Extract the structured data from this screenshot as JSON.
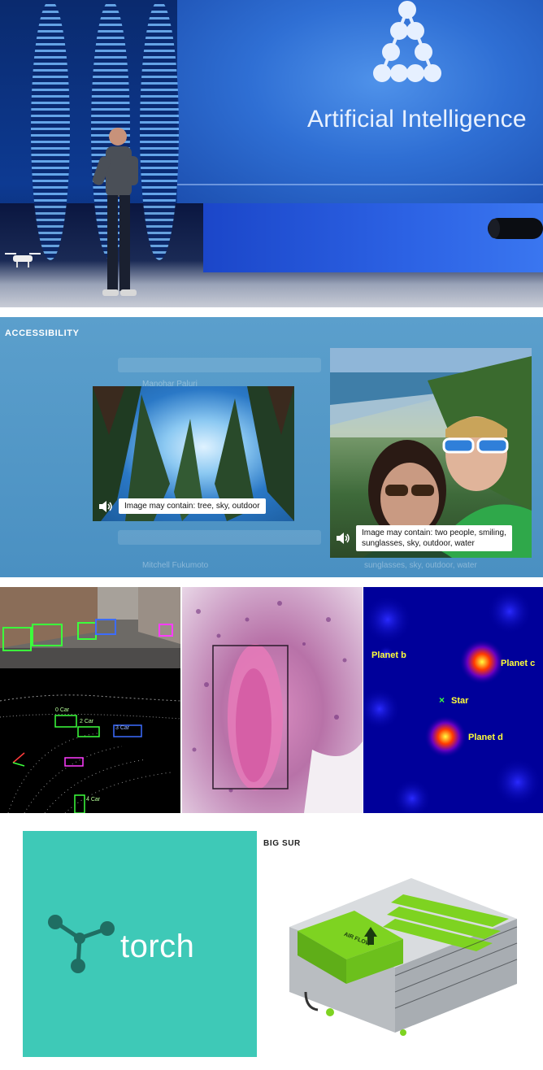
{
  "stage": {
    "title": "Artificial Intelligence"
  },
  "accessibility": {
    "label": "ACCESSIBILITY",
    "ghost_names": [
      "Manohar Paluri",
      "Mitchell Fukumoto"
    ],
    "ghost_caption": "sunglasses, sky, outdoor, water",
    "forest_caption": "Image may contain: tree, sky, outdoor",
    "selfie_caption_line1": "Image may contain: two people, smiling,",
    "selfie_caption_line2": "sunglasses, sky, outdoor, water"
  },
  "lidar": {
    "labels": [
      "0 Car",
      "2 Car",
      "3 Car",
      "4 Car"
    ]
  },
  "astro": {
    "planet_b": "Planet b",
    "planet_c": "Planet c",
    "planet_d": "Planet d",
    "star": "Star",
    "star_marker": "×"
  },
  "torch": {
    "word": "torch"
  },
  "bigsur": {
    "label": "BIG SUR",
    "airflow_text": "AIR FLOW"
  },
  "colors": {
    "torch_bg": "#3ec9b7",
    "accessibility_bg": "#4a90c2",
    "bigsur_green": "#7ed321"
  }
}
